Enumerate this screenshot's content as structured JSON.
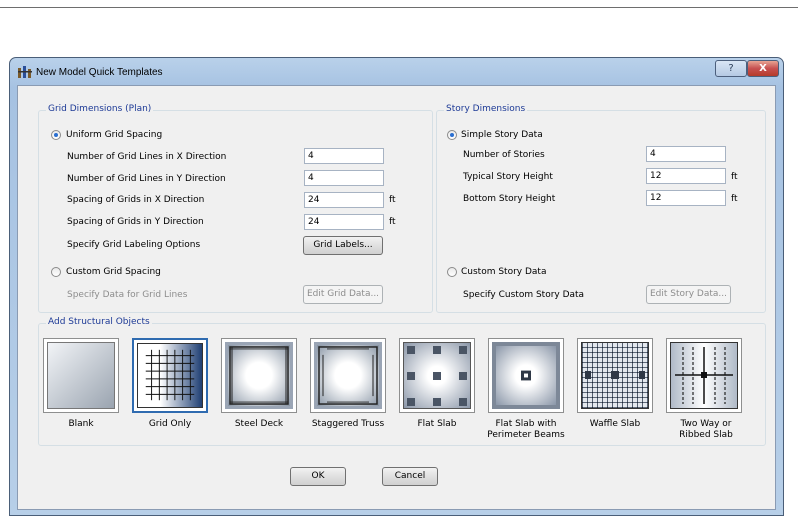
{
  "window": {
    "title": "New Model Quick Templates",
    "help_label": "?",
    "close_label": "X"
  },
  "grid": {
    "group_title": "Grid Dimensions (Plan)",
    "uniform_label": "Uniform Grid Spacing",
    "uniform_selected": true,
    "rows": [
      {
        "label": "Number of Grid Lines in X Direction",
        "value": "4",
        "unit": ""
      },
      {
        "label": "Number of Grid Lines in Y Direction",
        "value": "4",
        "unit": ""
      },
      {
        "label": "Spacing of Grids in X Direction",
        "value": "24",
        "unit": "ft"
      },
      {
        "label": "Spacing of Grids in Y Direction",
        "value": "24",
        "unit": "ft"
      }
    ],
    "labeling_label": "Specify Grid Labeling Options",
    "labels_button": "Grid Labels...",
    "custom_label": "Custom Grid Spacing",
    "custom_data_label": "Specify Data for Grid Lines",
    "edit_button": "Edit Grid Data..."
  },
  "story": {
    "group_title": "Story Dimensions",
    "simple_label": "Simple Story Data",
    "simple_selected": true,
    "rows": [
      {
        "label": "Number of Stories",
        "value": "4",
        "unit": ""
      },
      {
        "label": "Typical Story Height",
        "value": "12",
        "unit": "ft"
      },
      {
        "label": "Bottom Story Height",
        "value": "12",
        "unit": "ft"
      }
    ],
    "custom_label": "Custom Story Data",
    "custom_data_label": "Specify Custom Story Data",
    "edit_button": "Edit Story Data..."
  },
  "objects": {
    "group_title": "Add Structural Objects",
    "items": [
      {
        "label": "Blank",
        "icon": "blank-icon",
        "selected": false
      },
      {
        "label": "Grid Only",
        "icon": "grid-only-icon",
        "selected": true
      },
      {
        "label": "Steel Deck",
        "icon": "steel-deck-icon",
        "selected": false
      },
      {
        "label": "Staggered Truss",
        "icon": "staggered-truss-icon",
        "selected": false
      },
      {
        "label": "Flat Slab",
        "icon": "flat-slab-icon",
        "selected": false
      },
      {
        "label": "Flat Slab with Perimeter Beams",
        "icon": "flat-slab-perimeter-icon",
        "selected": false
      },
      {
        "label": "Waffle Slab",
        "icon": "waffle-slab-icon",
        "selected": false
      },
      {
        "label": "Two Way or Ribbed Slab",
        "icon": "ribbed-slab-icon",
        "selected": false
      }
    ]
  },
  "footer": {
    "ok_label": "OK",
    "cancel_label": "Cancel"
  },
  "colors": {
    "group_title": "#1d3a96",
    "window_frame": "#b9d1ea",
    "close": "#c75050"
  }
}
